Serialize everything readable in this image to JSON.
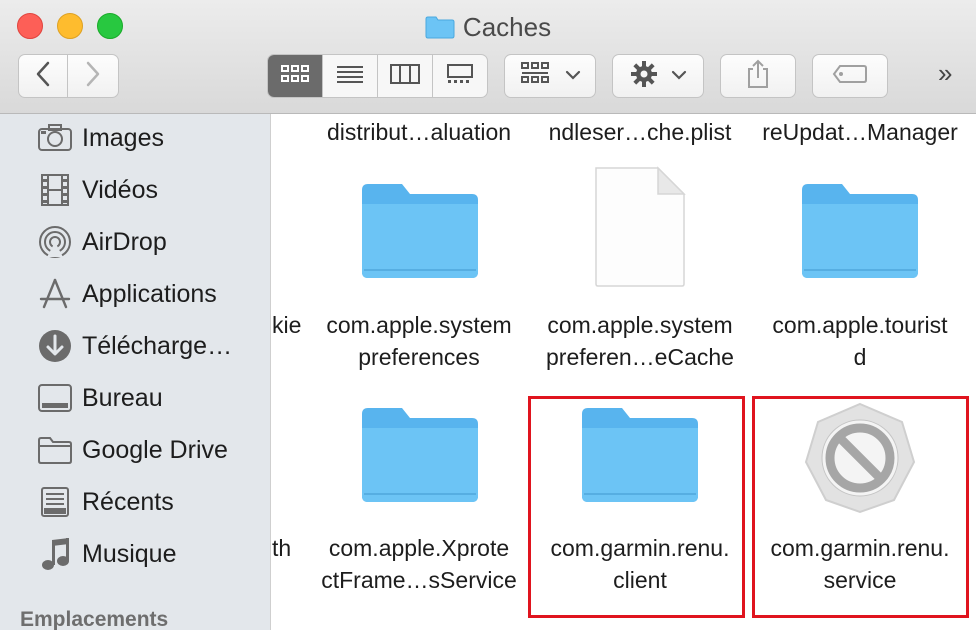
{
  "window": {
    "title": "Caches"
  },
  "toolbar": {
    "back_icon": "chevron-left-icon",
    "forward_icon": "chevron-right-icon",
    "views": [
      "icon-view-icon",
      "list-view-icon",
      "column-view-icon",
      "gallery-view-icon"
    ],
    "active_view": "icon-view-icon",
    "more_label": "»"
  },
  "sidebar": {
    "items": [
      {
        "label": "Images",
        "icon": "camera-icon"
      },
      {
        "label": "Vidéos",
        "icon": "film-icon"
      },
      {
        "label": "AirDrop",
        "icon": "airdrop-icon"
      },
      {
        "label": "Applications",
        "icon": "applications-icon"
      },
      {
        "label": "Télécharge…",
        "icon": "download-icon"
      },
      {
        "label": "Bureau",
        "icon": "desktop-icon"
      },
      {
        "label": "Google Drive",
        "icon": "folder-icon"
      },
      {
        "label": "Récents",
        "icon": "recents-icon"
      },
      {
        "label": "Musique",
        "icon": "music-icon"
      }
    ],
    "section_header": "Emplacements"
  },
  "files": {
    "row0": [
      {
        "line1": "distribut…aluation"
      },
      {
        "line1": "ndleser…che.plist"
      },
      {
        "line1": "reUpdat…Manager"
      }
    ],
    "row1_left_partial": "kie",
    "row1": [
      {
        "line1": "com.apple.system",
        "line2": "preferences",
        "icon": "folder-icon"
      },
      {
        "line1": "com.apple.system",
        "line2": "preferen…eCache",
        "icon": "document-icon"
      },
      {
        "line1": "com.apple.tourist",
        "line2": "d",
        "icon": "folder-icon"
      }
    ],
    "row2_left_partial": "th",
    "row2": [
      {
        "line1": "com.apple.Xprote",
        "line2": "ctFrame…sService",
        "icon": "folder-icon"
      },
      {
        "line1": "com.garmin.renu.",
        "line2": "client",
        "icon": "folder-icon",
        "highlighted": true
      },
      {
        "line1": "com.garmin.renu.",
        "line2": "service",
        "icon": "prohibited-app-icon",
        "highlighted": true
      }
    ]
  },
  "colors": {
    "folder": "#6cc4f5",
    "highlight": "#e0141e",
    "sidebar_bg": "#e3e7eb"
  }
}
